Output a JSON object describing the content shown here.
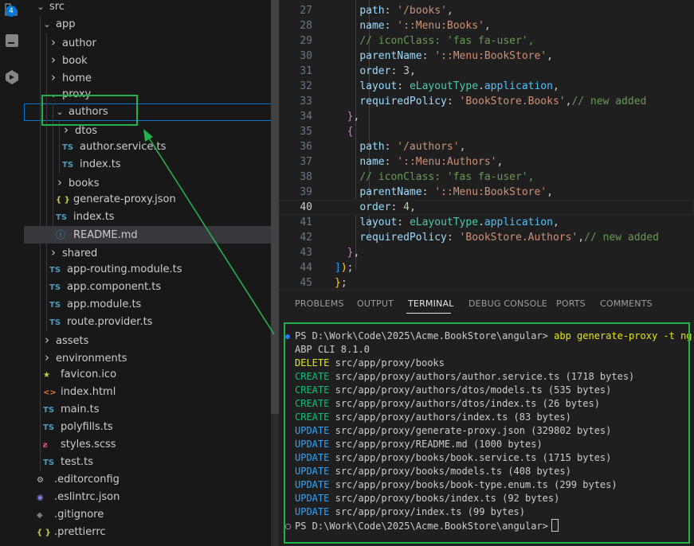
{
  "activity_bar": {
    "badge": "4"
  },
  "explorer": {
    "rows": [
      {
        "label": "src",
        "type": "folder",
        "open": true,
        "depth": 0
      },
      {
        "label": "app",
        "type": "folder",
        "open": true,
        "depth": 1
      },
      {
        "label": "author",
        "type": "folder",
        "open": false,
        "depth": 2
      },
      {
        "label": "book",
        "type": "folder",
        "open": false,
        "depth": 2
      },
      {
        "label": "home",
        "type": "folder",
        "open": false,
        "depth": 2
      },
      {
        "label": "proxy",
        "type": "folder",
        "open": true,
        "depth": 2
      },
      {
        "label": "authors",
        "type": "folder",
        "open": true,
        "depth": 3,
        "selected": true
      },
      {
        "label": "dtos",
        "type": "folder",
        "open": false,
        "depth": 4
      },
      {
        "label": "author.service.ts",
        "type": "ts",
        "depth": 4
      },
      {
        "label": "index.ts",
        "type": "ts",
        "depth": 4
      },
      {
        "label": "books",
        "type": "folder",
        "open": false,
        "depth": 3
      },
      {
        "label": "generate-proxy.json",
        "type": "json",
        "depth": 3
      },
      {
        "label": "index.ts",
        "type": "ts",
        "depth": 3
      },
      {
        "label": "README.md",
        "type": "info",
        "depth": 3,
        "highlight": true
      },
      {
        "label": "shared",
        "type": "folder",
        "open": false,
        "depth": 2
      },
      {
        "label": "app-routing.module.ts",
        "type": "ts",
        "depth": 2
      },
      {
        "label": "app.component.ts",
        "type": "ts",
        "depth": 2
      },
      {
        "label": "app.module.ts",
        "type": "ts",
        "depth": 2
      },
      {
        "label": "route.provider.ts",
        "type": "ts",
        "depth": 2
      },
      {
        "label": "assets",
        "type": "folder",
        "open": false,
        "depth": 1
      },
      {
        "label": "environments",
        "type": "folder",
        "open": false,
        "depth": 1
      },
      {
        "label": "favicon.ico",
        "type": "star",
        "depth": 1
      },
      {
        "label": "index.html",
        "type": "html",
        "depth": 1
      },
      {
        "label": "main.ts",
        "type": "ts",
        "depth": 1
      },
      {
        "label": "polyfills.ts",
        "type": "ts",
        "depth": 1
      },
      {
        "label": "styles.scss",
        "type": "scss",
        "depth": 1
      },
      {
        "label": "test.ts",
        "type": "ts",
        "depth": 1
      },
      {
        "label": ".editorconfig",
        "type": "gear",
        "depth": 0
      },
      {
        "label": ".eslintrc.json",
        "type": "eslint",
        "depth": 0
      },
      {
        "label": ".gitignore",
        "type": "git",
        "depth": 0
      },
      {
        "label": ".prettierrc",
        "type": "json",
        "depth": 0
      }
    ]
  },
  "editor": {
    "current_line": "40",
    "lines": [
      {
        "num": "27",
        "tokens": [
          [
            "p",
            "    "
          ],
          [
            "prop",
            "path"
          ],
          [
            "p",
            ": "
          ],
          [
            "str",
            "'/books'"
          ],
          [
            "p",
            ","
          ]
        ]
      },
      {
        "num": "28",
        "tokens": [
          [
            "p",
            "    "
          ],
          [
            "prop",
            "name"
          ],
          [
            "p",
            ": "
          ],
          [
            "str",
            "'::Menu:Books'"
          ],
          [
            "p",
            ","
          ]
        ]
      },
      {
        "num": "29",
        "tokens": [
          [
            "p",
            "    "
          ],
          [
            "comment",
            "// iconClass: 'fas fa-user',"
          ]
        ]
      },
      {
        "num": "30",
        "tokens": [
          [
            "p",
            "    "
          ],
          [
            "prop",
            "parentName"
          ],
          [
            "p",
            ": "
          ],
          [
            "str",
            "'::Menu:BookStore'"
          ],
          [
            "p",
            ","
          ]
        ]
      },
      {
        "num": "31",
        "tokens": [
          [
            "p",
            "    "
          ],
          [
            "prop",
            "order"
          ],
          [
            "p",
            ": "
          ],
          [
            "num",
            "3"
          ],
          [
            "p",
            ","
          ]
        ]
      },
      {
        "num": "32",
        "tokens": [
          [
            "p",
            "    "
          ],
          [
            "prop",
            "layout"
          ],
          [
            "p",
            ": "
          ],
          [
            "id",
            "eLayoutType"
          ],
          [
            "p",
            "."
          ],
          [
            "enum",
            "application"
          ],
          [
            "p",
            ","
          ]
        ]
      },
      {
        "num": "33",
        "tokens": [
          [
            "p",
            "    "
          ],
          [
            "prop",
            "requiredPolicy"
          ],
          [
            "p",
            ": "
          ],
          [
            "str",
            "'BookStore.Books'"
          ],
          [
            "p",
            ","
          ],
          [
            "comment",
            "// new added"
          ]
        ]
      },
      {
        "num": "34",
        "tokens": [
          [
            "p",
            "  "
          ],
          [
            "b1",
            "}"
          ],
          [
            "p",
            ","
          ]
        ]
      },
      {
        "num": "35",
        "tokens": [
          [
            "p",
            "  "
          ],
          [
            "b1",
            "{"
          ]
        ]
      },
      {
        "num": "36",
        "tokens": [
          [
            "p",
            "    "
          ],
          [
            "prop",
            "path"
          ],
          [
            "p",
            ": "
          ],
          [
            "str",
            "'/authors'"
          ],
          [
            "p",
            ","
          ]
        ]
      },
      {
        "num": "37",
        "tokens": [
          [
            "p",
            "    "
          ],
          [
            "prop",
            "name"
          ],
          [
            "p",
            ": "
          ],
          [
            "str",
            "'::Menu:Authors'"
          ],
          [
            "p",
            ","
          ]
        ]
      },
      {
        "num": "38",
        "tokens": [
          [
            "p",
            "    "
          ],
          [
            "comment",
            "// iconClass: 'fas fa-user',"
          ]
        ]
      },
      {
        "num": "39",
        "tokens": [
          [
            "p",
            "    "
          ],
          [
            "prop",
            "parentName"
          ],
          [
            "p",
            ": "
          ],
          [
            "str",
            "'::Menu:BookStore'"
          ],
          [
            "p",
            ","
          ]
        ]
      },
      {
        "num": "40",
        "tokens": [
          [
            "p",
            "    "
          ],
          [
            "prop",
            "order"
          ],
          [
            "p",
            ": "
          ],
          [
            "num",
            "4"
          ],
          [
            "p",
            ","
          ]
        ]
      },
      {
        "num": "41",
        "tokens": [
          [
            "p",
            "    "
          ],
          [
            "prop",
            "layout"
          ],
          [
            "p",
            ": "
          ],
          [
            "id",
            "eLayoutType"
          ],
          [
            "p",
            "."
          ],
          [
            "enum",
            "application"
          ],
          [
            "p",
            ","
          ]
        ]
      },
      {
        "num": "42",
        "tokens": [
          [
            "p",
            "    "
          ],
          [
            "prop",
            "requiredPolicy"
          ],
          [
            "p",
            ": "
          ],
          [
            "str",
            "'BookStore.Authors'"
          ],
          [
            "p",
            ","
          ],
          [
            "comment",
            "// new added"
          ]
        ]
      },
      {
        "num": "43",
        "tokens": [
          [
            "p",
            "  "
          ],
          [
            "b1",
            "}"
          ],
          [
            "p",
            ","
          ]
        ]
      },
      {
        "num": "44",
        "tokens": [
          [
            "b2",
            "]"
          ],
          [
            "b0",
            ")"
          ],
          [
            "p",
            ";"
          ]
        ]
      },
      {
        "num": "45",
        "tokens": [
          [
            "b0",
            "}"
          ],
          [
            "p",
            ";"
          ]
        ]
      }
    ]
  },
  "panel": {
    "tabs": [
      "PROBLEMS",
      "OUTPUT",
      "TERMINAL",
      "DEBUG CONSOLE",
      "PORTS",
      "COMMENTS"
    ],
    "active_tab": "TERMINAL"
  },
  "terminal": {
    "prompt": "PS D:\\Work\\Code\\2025\\Acme.BookStore\\angular>",
    "command": "abp generate-proxy -t ng",
    "version": "ABP CLI 8.1.0",
    "output": [
      {
        "action": "DELETE",
        "path": "src/app/proxy/books"
      },
      {
        "action": "CREATE",
        "path": "src/app/proxy/authors/author.service.ts (1718 bytes)"
      },
      {
        "action": "CREATE",
        "path": "src/app/proxy/authors/dtos/models.ts (535 bytes)"
      },
      {
        "action": "CREATE",
        "path": "src/app/proxy/authors/dtos/index.ts (26 bytes)"
      },
      {
        "action": "CREATE",
        "path": "src/app/proxy/authors/index.ts (83 bytes)"
      },
      {
        "action": "UPDATE",
        "path": "src/app/proxy/generate-proxy.json (329802 bytes)"
      },
      {
        "action": "UPDATE",
        "path": "src/app/proxy/README.md (1000 bytes)"
      },
      {
        "action": "UPDATE",
        "path": "src/app/proxy/books/book.service.ts (1715 bytes)"
      },
      {
        "action": "UPDATE",
        "path": "src/app/proxy/books/models.ts (408 bytes)"
      },
      {
        "action": "UPDATE",
        "path": "src/app/proxy/books/book-type.enum.ts (299 bytes)"
      },
      {
        "action": "UPDATE",
        "path": "src/app/proxy/books/index.ts (92 bytes)"
      },
      {
        "action": "UPDATE",
        "path": "src/app/proxy/index.ts (99 bytes)"
      }
    ]
  },
  "colors": {
    "annotation": "#22b14c",
    "accent": "#0078d4"
  }
}
